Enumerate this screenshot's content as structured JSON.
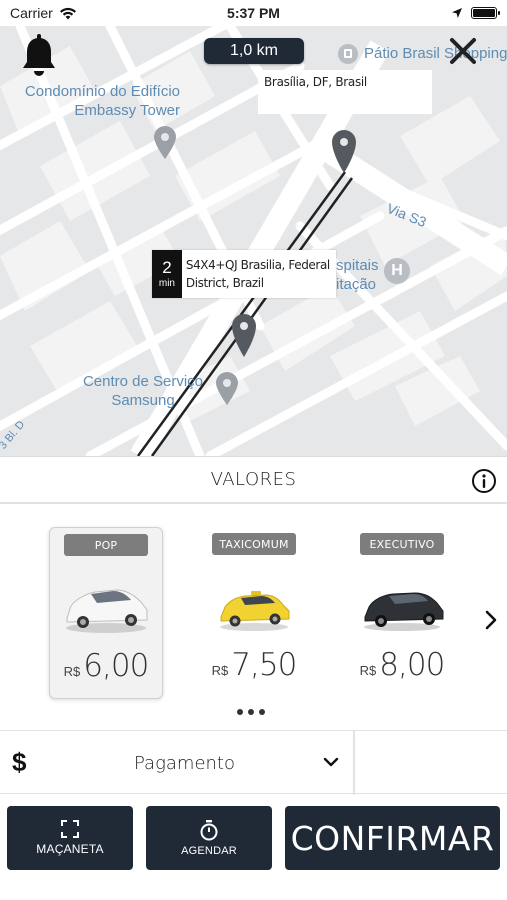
{
  "status_bar": {
    "carrier": "Carrier",
    "time": "5:37 PM",
    "icons": [
      "wifi-icon",
      "location-arrow-icon",
      "battery-icon"
    ],
    "battery_level": 1.0
  },
  "map": {
    "distance": "1,0 km",
    "destination_address": "Brasília, DF, Brasil",
    "origin_eta_value": "2",
    "origin_eta_unit": "min",
    "origin_address": "S4X4+QJ Brasilia, Federal District, Brazil",
    "labels": {
      "embassy_tower": "Condomínio do Edifício Embassy Tower",
      "patio_brasil": "Pátio Brasil Shopping",
      "via_s3": "Via S3",
      "hospital": "spitais itação",
      "samsung": "Centro de Serviço Samsung",
      "road_corner": "3 Bl. D"
    },
    "colors": {
      "route": "#222222",
      "pin": "#555a60",
      "poi_label": "#5e8cb3"
    }
  },
  "values_section": {
    "title": "VALORES",
    "info_icon": "info-icon"
  },
  "vehicles": [
    {
      "name": "POP",
      "currency": "R$",
      "price": "6,00",
      "color": "white",
      "selected": true
    },
    {
      "name": "TAXICOMUM",
      "currency": "R$",
      "price": "7,50",
      "color": "yellow",
      "selected": false
    },
    {
      "name": "EXECUTIVO",
      "currency": "R$",
      "price": "8,00",
      "color": "black",
      "selected": false
    }
  ],
  "payment": {
    "icon": "$",
    "label": "Pagamento"
  },
  "actions": {
    "door_handle": "MAÇANETA",
    "schedule": "AGENDAR",
    "confirm": "CONFIRMAR"
  },
  "theme": {
    "dark_button": "#1f2a36",
    "badge_gray": "#7d7d7d"
  }
}
